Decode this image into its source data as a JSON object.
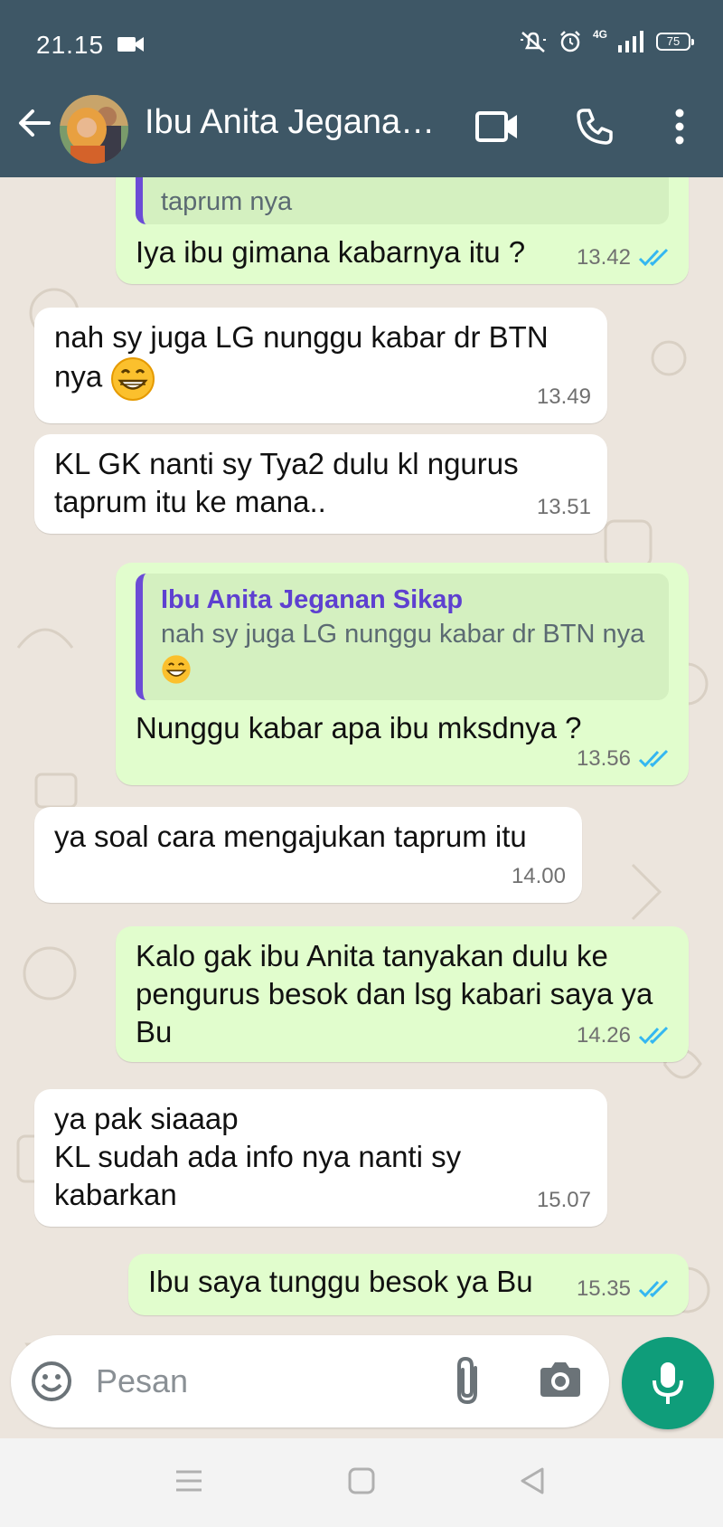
{
  "status_bar": {
    "time": "21.15",
    "network_label": "4G",
    "battery": "75"
  },
  "header": {
    "contact_name": "Ibu Anita Jeganan Sikap"
  },
  "colors": {
    "header_bg": "#3e5766",
    "incoming_bubble": "#ffffff",
    "outgoing_bubble": "#e1fdcd",
    "read_ticks": "#34b7f1",
    "mic_button": "#0f9d7a",
    "quote_accent": "#6b4cd6"
  },
  "messages": [
    {
      "dir": "out",
      "quote_text": "taprum nya",
      "text": "Iya ibu gimana kabarnya itu ?",
      "time": "13.42",
      "ticks": "read"
    },
    {
      "dir": "in",
      "text": "nah sy juga LG nunggu kabar dr BTN nya",
      "emoji": "grinning-face",
      "time": "13.49"
    },
    {
      "dir": "in",
      "text": "KL GK nanti sy Tya2 dulu kl ngurus taprum itu ke mana..",
      "time": "13.51"
    },
    {
      "dir": "out",
      "quote_author": "Ibu Anita Jeganan Sikap",
      "quote_text": "nah sy juga LG nunggu kabar dr BTN nya",
      "quote_emoji": "grinning-face",
      "text": "Nunggu kabar apa ibu mksdnya ?",
      "time": "13.56",
      "ticks": "read"
    },
    {
      "dir": "in",
      "text": "ya soal cara mengajukan taprum itu",
      "time": "14.00"
    },
    {
      "dir": "out",
      "text": "Kalo gak ibu Anita tanyakan dulu ke pengurus besok dan lsg kabari saya ya Bu",
      "time": "14.26",
      "ticks": "read"
    },
    {
      "dir": "in",
      "text": "ya pak siaaap\nKL sudah ada info nya nanti sy kabarkan",
      "time": "15.07"
    },
    {
      "dir": "out",
      "text": "Ibu saya tunggu besok ya Bu",
      "time": "15.35",
      "ticks": "read"
    }
  ],
  "composer": {
    "placeholder": "Pesan"
  },
  "icons": [
    "back-arrow-icon",
    "video-call-icon",
    "phone-icon",
    "more-vert-icon",
    "emoji-icon",
    "attach-icon",
    "camera-icon",
    "mic-icon",
    "menu-nav-icon",
    "home-nav-icon",
    "back-nav-icon"
  ]
}
